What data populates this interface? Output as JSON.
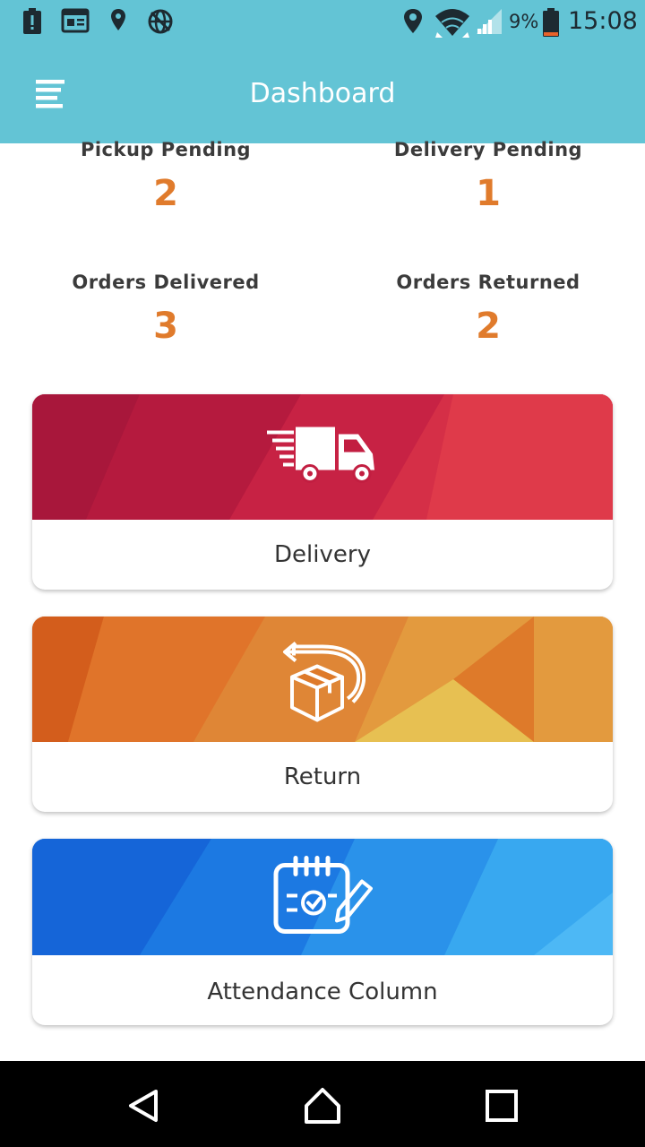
{
  "status_bar": {
    "battery_percent": "9%",
    "time": "15:08",
    "icons": [
      "battery-alert-icon",
      "news-icon",
      "location-pin-icon",
      "vpn-globe-icon",
      "location-icon",
      "wifi-icon",
      "signal-icon",
      "battery-icon"
    ]
  },
  "app_bar": {
    "title": "Dashboard",
    "menu_icon": "menu-icon",
    "color": "#63c4d5"
  },
  "stats": [
    {
      "label": "Pickup Pending",
      "value": "2"
    },
    {
      "label": "Delivery Pending",
      "value": "1"
    },
    {
      "label": "Orders Delivered",
      "value": "3"
    },
    {
      "label": "Orders Returned",
      "value": "2"
    }
  ],
  "stat_value_color": "#e07b2c",
  "cards": [
    {
      "label": "Delivery",
      "icon": "delivery-truck-icon",
      "colors": [
        "#b3193f",
        "#e03a4a"
      ]
    },
    {
      "label": "Return",
      "icon": "return-box-icon",
      "colors": [
        "#d9641f",
        "#e9b04a"
      ]
    },
    {
      "label": "Attendance Column",
      "icon": "attendance-calendar-icon",
      "colors": [
        "#1565d8",
        "#4db8f5"
      ]
    }
  ],
  "nav_bar": {
    "icons": [
      "back-icon",
      "home-icon",
      "recents-icon"
    ]
  }
}
